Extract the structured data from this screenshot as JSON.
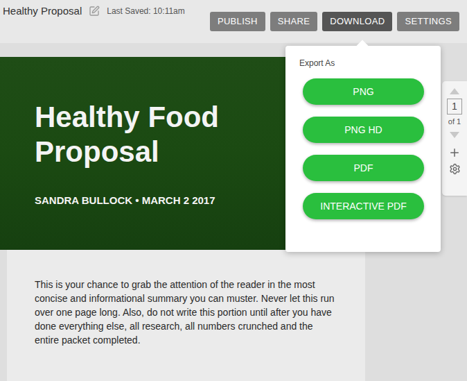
{
  "window": {
    "title": "Healthy Proposal",
    "last_saved": "Last Saved: 10:11am"
  },
  "toolbar": [
    {
      "label": "PUBLISH",
      "selected": false
    },
    {
      "label": "SHARE",
      "selected": false
    },
    {
      "label": "DOWNLOAD",
      "selected": true
    },
    {
      "label": "SETTINGS",
      "selected": false
    }
  ],
  "export_menu": {
    "heading": "Export As",
    "options": [
      "PNG",
      "PNG HD",
      "PDF",
      "INTERACTIVE PDF"
    ]
  },
  "page_nav": {
    "current": "1",
    "total": "of 1"
  },
  "document": {
    "title": "Healthy Food Proposal",
    "byline": "SANDRA BULLOCK • MARCH 2 2017",
    "body": "This is your chance to grab the attention of the reader in the most concise and informational summary you can muster. Never let this run over one page long. Also, do not write this portion until after you have done everything else, all research, all numbers crunched and the entire packet completed."
  }
}
